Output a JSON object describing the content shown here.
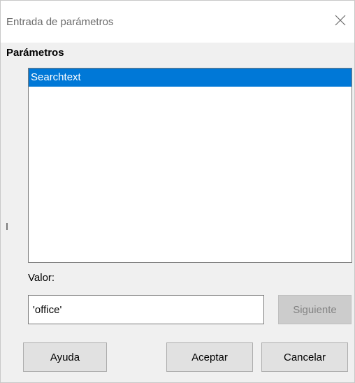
{
  "window": {
    "title": "Entrada de parámetros",
    "close_icon": "close-icon"
  },
  "parameters": {
    "label": "Parámetros",
    "items": [
      "Searchtext"
    ],
    "selected_index": 0
  },
  "value": {
    "label": "Valor:",
    "input_value": "'office'"
  },
  "buttons": {
    "next": "Siguiente",
    "help": "Ayuda",
    "ok": "Aceptar",
    "cancel": "Cancelar"
  },
  "colors": {
    "selection": "#0078d7",
    "dialog_bg": "#f0f0f0"
  }
}
